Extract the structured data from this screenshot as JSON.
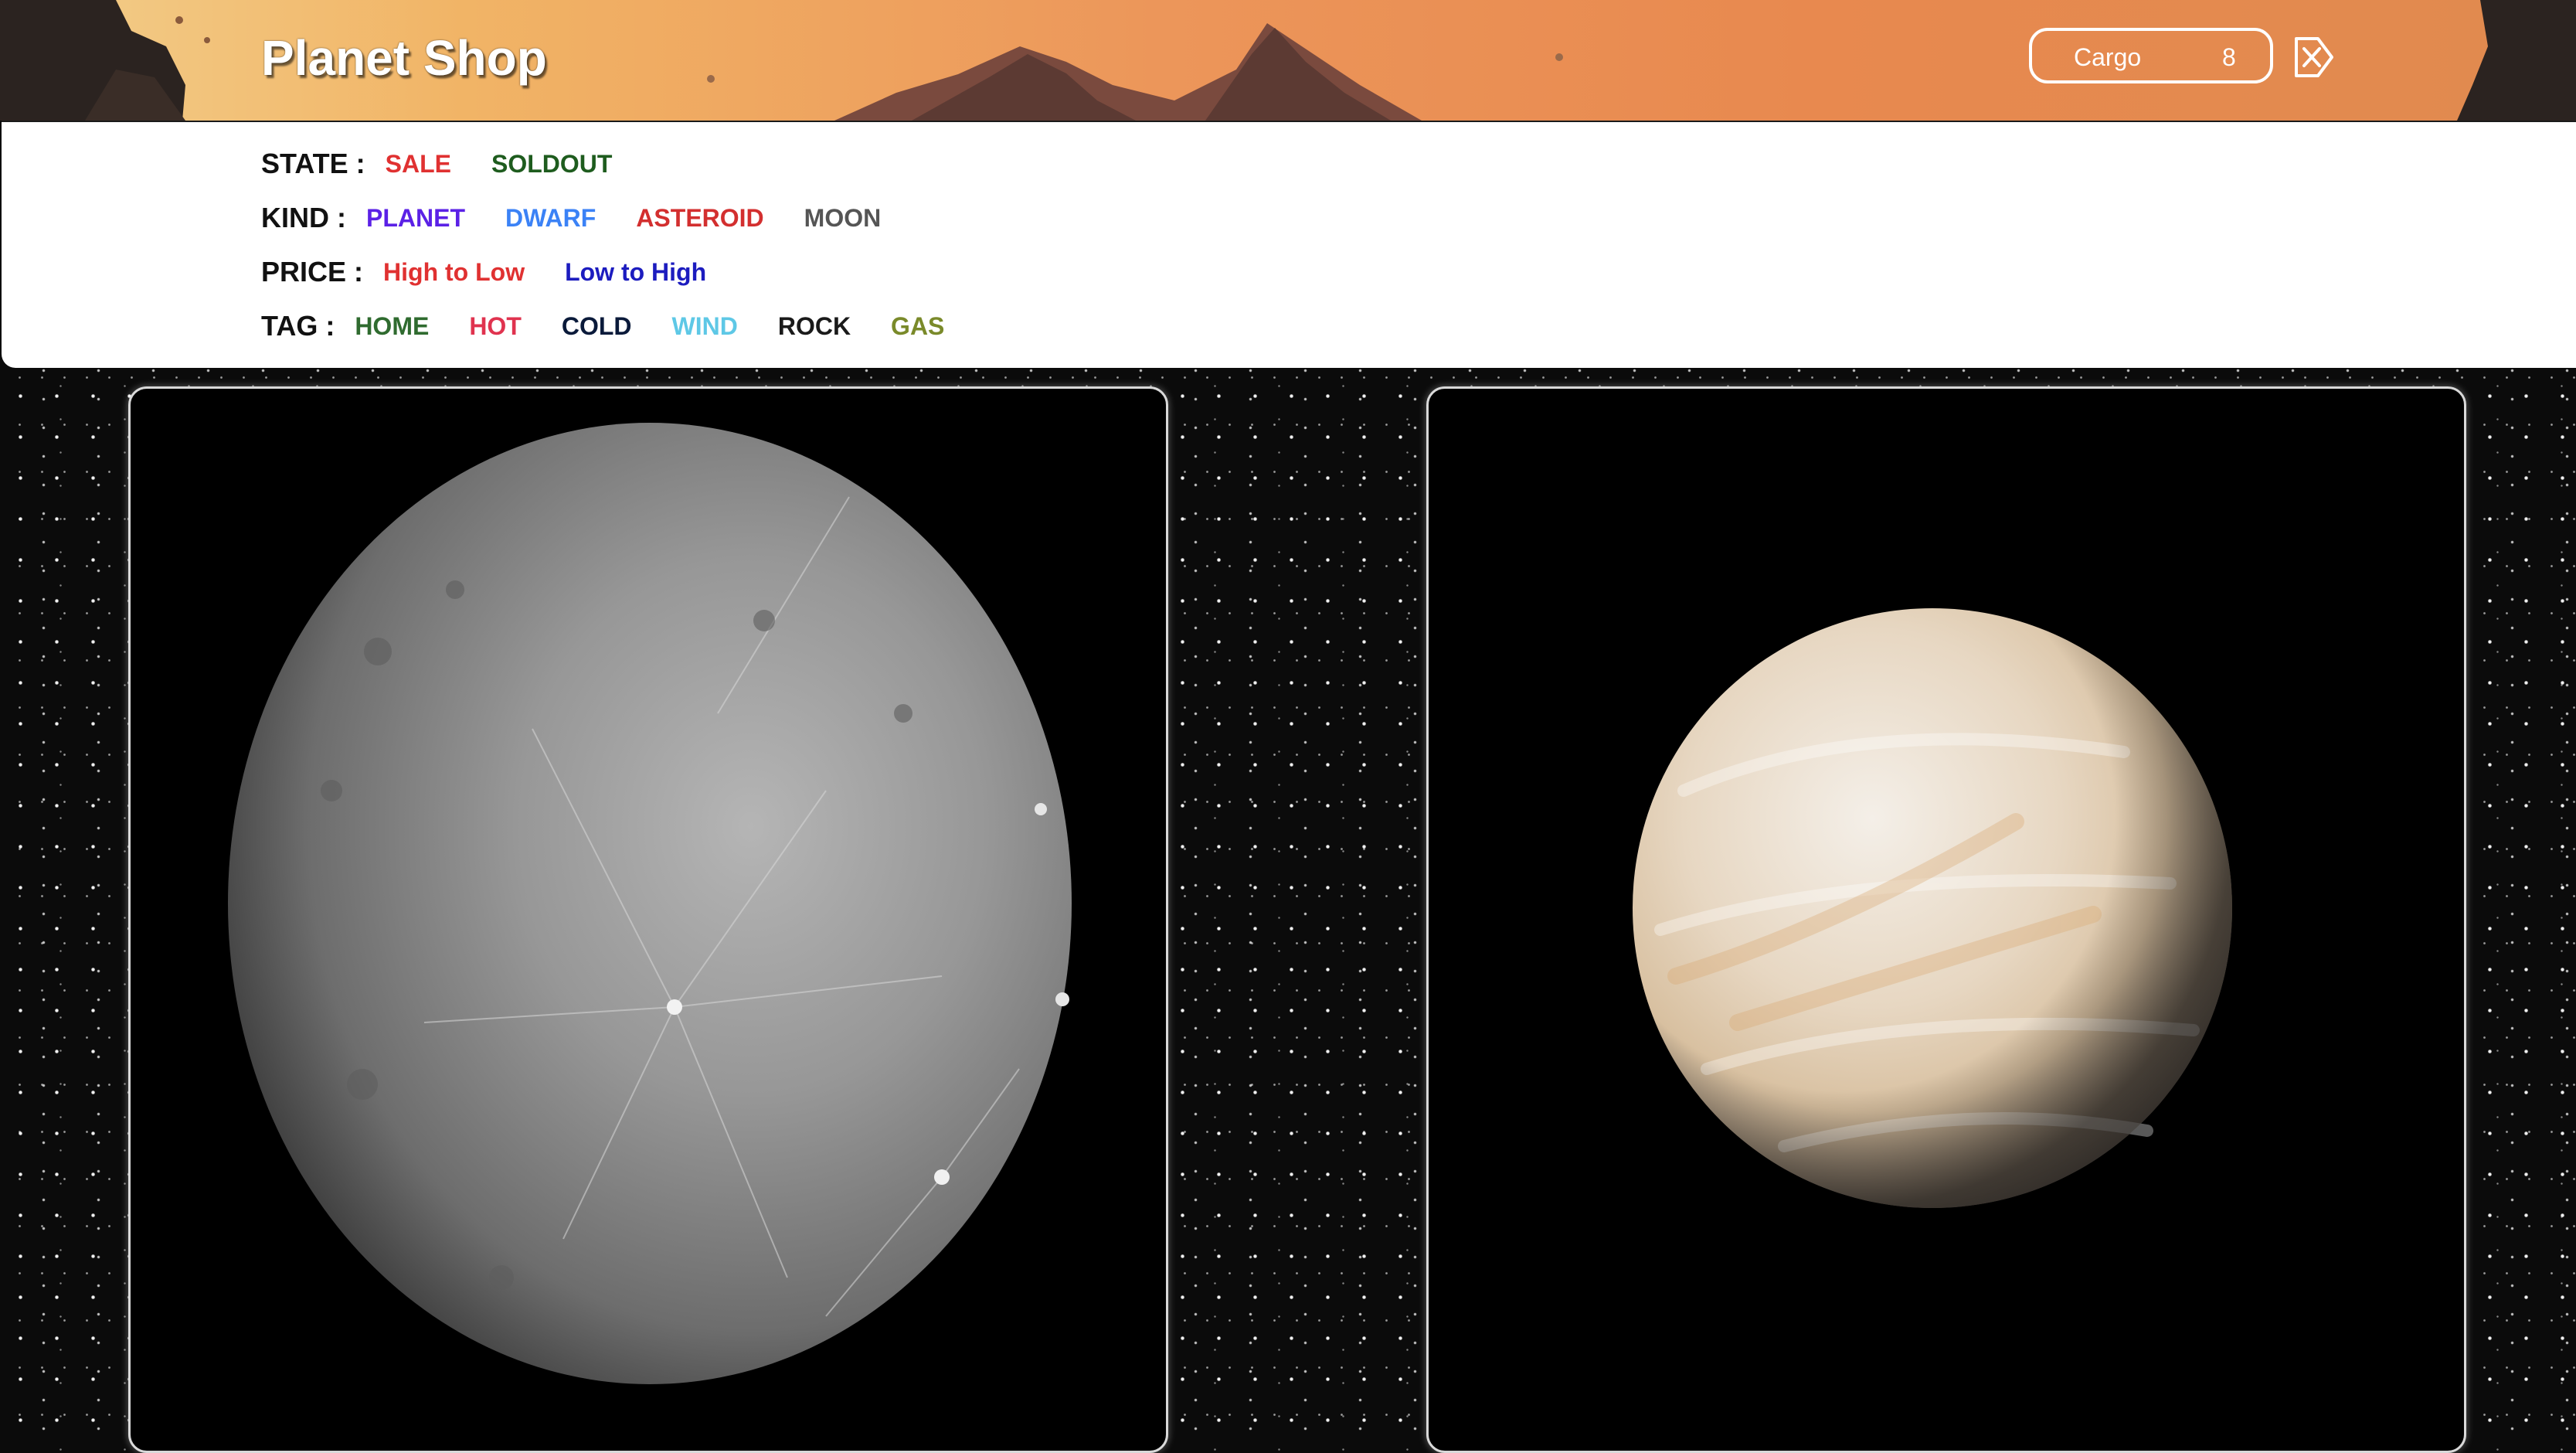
{
  "header": {
    "title": "Planet Shop",
    "cargo": {
      "label": "Cargo",
      "count": "8"
    },
    "logout_icon": "logout-x-icon"
  },
  "filters": {
    "state": {
      "label": "STATE :",
      "options": [
        {
          "label": "SALE",
          "color": "#e03131"
        },
        {
          "label": "SOLDOUT",
          "color": "#1e5c1e"
        }
      ]
    },
    "kind": {
      "label": "KIND :",
      "options": [
        {
          "label": "PLANET",
          "color": "#5b21e6"
        },
        {
          "label": "DWARF",
          "color": "#3b82f6"
        },
        {
          "label": "ASTEROID",
          "color": "#d32f2f"
        },
        {
          "label": "MOON",
          "color": "#555555"
        }
      ]
    },
    "price": {
      "label": "PRICE :",
      "options": [
        {
          "label": "High to Low",
          "color": "#e03131"
        },
        {
          "label": "Low to High",
          "color": "#1c1cbf"
        }
      ]
    },
    "tag": {
      "label": "TAG :",
      "options": [
        {
          "label": "HOME",
          "color": "#2f6b2f"
        },
        {
          "label": "HOT",
          "color": "#e0334f"
        },
        {
          "label": "COLD",
          "color": "#0a1a3a"
        },
        {
          "label": "WIND",
          "color": "#5ec8e6"
        },
        {
          "label": "ROCK",
          "color": "#1a1a1a"
        },
        {
          "label": "GAS",
          "color": "#7a8a2a"
        }
      ]
    }
  },
  "products": [
    {
      "image": "mercury-planet-image"
    },
    {
      "image": "venus-planet-image"
    }
  ]
}
